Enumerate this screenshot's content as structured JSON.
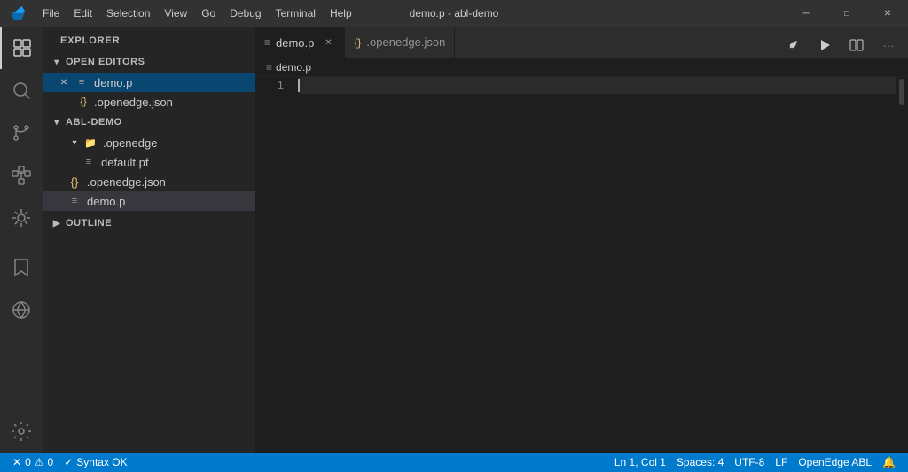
{
  "titlebar": {
    "title": "demo.p - abl-demo",
    "menus": [
      "File",
      "Edit",
      "Selection",
      "View",
      "Go",
      "Debug",
      "Terminal",
      "Help"
    ],
    "controls": [
      "─",
      "□",
      "✕"
    ]
  },
  "sidebar": {
    "header": "Explorer",
    "open_editors": {
      "label": "Open Editors",
      "files": [
        {
          "name": "demo.p",
          "icon": "file",
          "active": true,
          "has_close": true
        },
        {
          "name": ".openedge.json",
          "icon": "json",
          "active": false
        }
      ]
    },
    "project": {
      "label": "ABL-DEMO",
      "items": [
        {
          "name": ".openedge",
          "icon": "folder",
          "indent": 1
        },
        {
          "name": "default.pf",
          "icon": "file",
          "indent": 2
        },
        {
          "name": ".openedge.json",
          "icon": "json",
          "indent": 1
        },
        {
          "name": "demo.p",
          "icon": "file",
          "indent": 1,
          "selected": true
        }
      ]
    },
    "outline": {
      "label": "Outline"
    }
  },
  "editor": {
    "tabs": [
      {
        "name": "demo.p",
        "icon": "≡",
        "active": true
      },
      {
        "name": ".openedge.json",
        "icon": "{}",
        "active": false
      }
    ],
    "breadcrumb": "demo.p",
    "line_number": "1"
  },
  "statusbar": {
    "errors": "0",
    "warnings": "0",
    "syntax": "Syntax OK",
    "position": "Ln 1, Col 1",
    "spaces": "Spaces: 4",
    "encoding": "UTF-8",
    "line_ending": "LF",
    "language": "OpenEdge ABL",
    "bell": "🔔"
  }
}
